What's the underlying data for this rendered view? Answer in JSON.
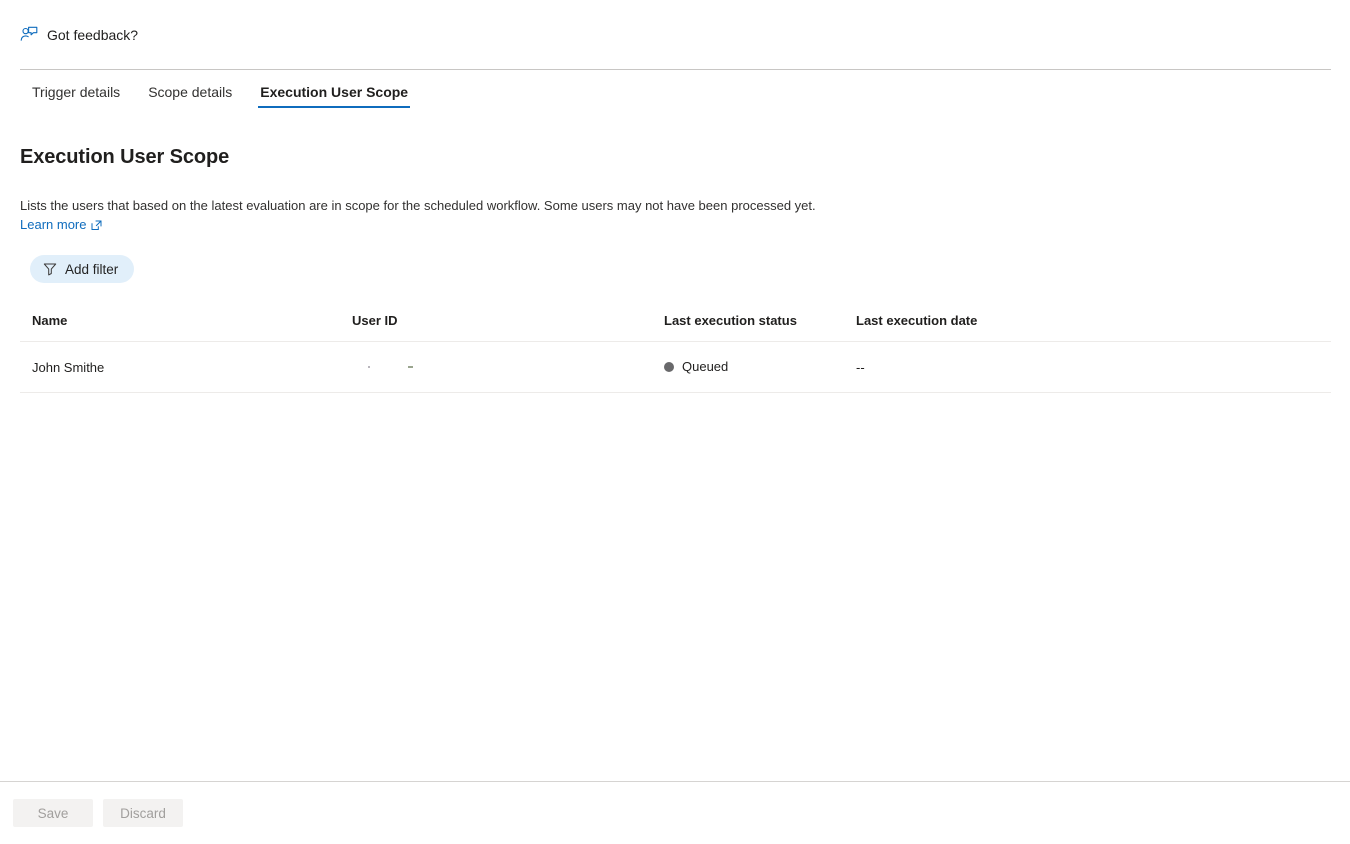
{
  "feedback": {
    "label": "Got feedback?",
    "icon": "person-feedback-icon",
    "accent": "#0f6cbd"
  },
  "tabs": [
    {
      "label": "Trigger details",
      "active": false
    },
    {
      "label": "Scope details",
      "active": false
    },
    {
      "label": "Execution User Scope",
      "active": true
    }
  ],
  "main": {
    "title": "Execution User Scope",
    "description": "Lists the users that based on the latest evaluation are in scope for the scheduled workflow. Some users may not have been processed yet.",
    "learn_more": "Learn more",
    "learn_more_icon": "open-in-new-icon"
  },
  "toolbar": {
    "add_filter_label": "Add filter",
    "add_filter_icon": "funnel-icon",
    "add_filter_bg": "#e1effa"
  },
  "table": {
    "columns": [
      "Name",
      "User ID",
      "Last execution status",
      "Last execution date"
    ],
    "rows": [
      {
        "name": "John Smithe",
        "user_id": "",
        "status": "Queued",
        "status_color": "#69696b",
        "date": "--"
      }
    ]
  },
  "footer": {
    "save_label": "Save",
    "discard_label": "Discard"
  }
}
